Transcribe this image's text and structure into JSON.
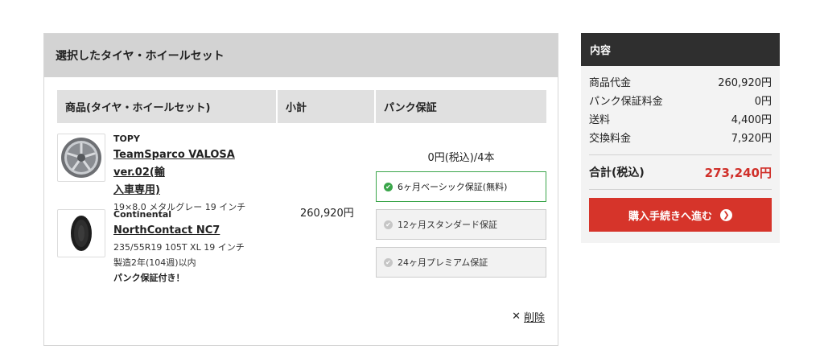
{
  "panel": {
    "title": "選択したタイヤ・ホイールセット"
  },
  "table": {
    "headers": [
      "商品(タイヤ・ホイールセット)",
      "小計",
      "パンク保証"
    ]
  },
  "products": [
    {
      "brand": "TOPY",
      "name_line1": "TeamSparco VALOSA ver.02(輸",
      "name_line2": "入車専用)",
      "specs": [
        "19×8.0 メタルグレー 19 インチ"
      ],
      "note": "",
      "icon": "wheel-icon"
    },
    {
      "brand": "Continental",
      "name_line1": "NorthContact NC7",
      "name_line2": "",
      "specs": [
        "235/55R19 105T XL 19 インチ",
        "製造2年(104週)以内"
      ],
      "note": "パンク保証付き！",
      "icon": "tire-icon"
    }
  ],
  "subtotal": "260,920円",
  "warranty": {
    "per_unit": "0円(税込)/4本",
    "options": [
      {
        "label": "6ヶ月ベーシック保証(無料)",
        "selected": true
      },
      {
        "label": "12ヶ月スタンダード保証",
        "selected": false
      },
      {
        "label": "24ヶ月プレミアム保証",
        "selected": false
      }
    ]
  },
  "delete": {
    "icon": "close-icon",
    "label": "削除"
  },
  "summary": {
    "title": "内容",
    "rows": [
      {
        "label": "商品代金",
        "value": "260,920円"
      },
      {
        "label": "パンク保証料金",
        "value": "0円"
      },
      {
        "label": "送料",
        "value": "4,400円"
      },
      {
        "label": "交換料金",
        "value": "7,920円"
      }
    ],
    "total_label": "合計(税込)",
    "total_value": "273,240円",
    "checkout_label": "購入手続きへ進む"
  },
  "colors": {
    "accent_red": "#d6342a",
    "total_red": "#d0302a",
    "selected_green": "#3aa54a",
    "summary_header": "#2f2f2f"
  }
}
